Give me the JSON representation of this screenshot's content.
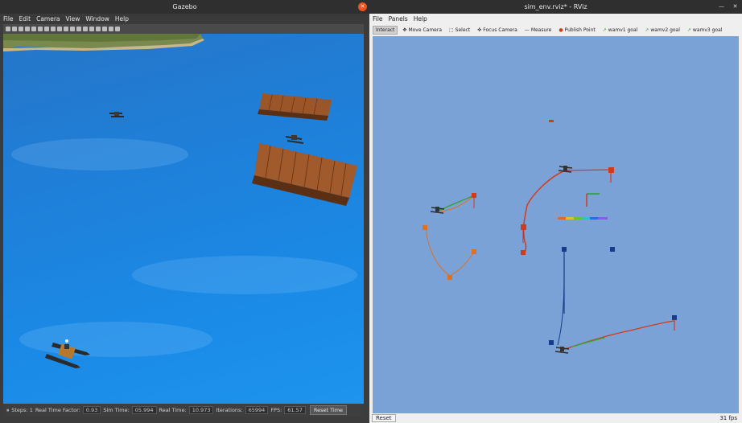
{
  "gazebo": {
    "title": "Gazebo",
    "menu": [
      "File",
      "Edit",
      "Camera",
      "View",
      "Window",
      "Help"
    ],
    "status": {
      "steps_label": "Steps: 1",
      "rtf_label": "Real Time Factor:",
      "rtf_value": "0.93",
      "sim_time_label": "Sim Time:",
      "sim_time_value": "05.994",
      "real_time_label": "Real Time:",
      "real_time_value": "10.973",
      "iterations_label": "Iterations:",
      "iterations_value": "65994",
      "fps_label": "FPS:",
      "fps_value": "61.57",
      "reset_time": "Reset Time"
    }
  },
  "rviz": {
    "title": "sim_env.rviz* - RViz",
    "menu": [
      "File",
      "Panels",
      "Help"
    ],
    "tools": [
      "Interact",
      "Move Camera",
      "Select",
      "Focus Camera",
      "Measure",
      "Publish Point",
      "wamv1 goal",
      "wamv2 goal",
      "wamv3 goal"
    ],
    "reset": "Reset",
    "fps": "31 fps"
  },
  "colors": {
    "water": "#1f82dc",
    "rviz_bg": "#7aa2d6",
    "wood": "#8a4a22",
    "goal_red": "#d23a1c",
    "goal_orange": "#e07020",
    "goal_blue": "#1a3a8a"
  }
}
